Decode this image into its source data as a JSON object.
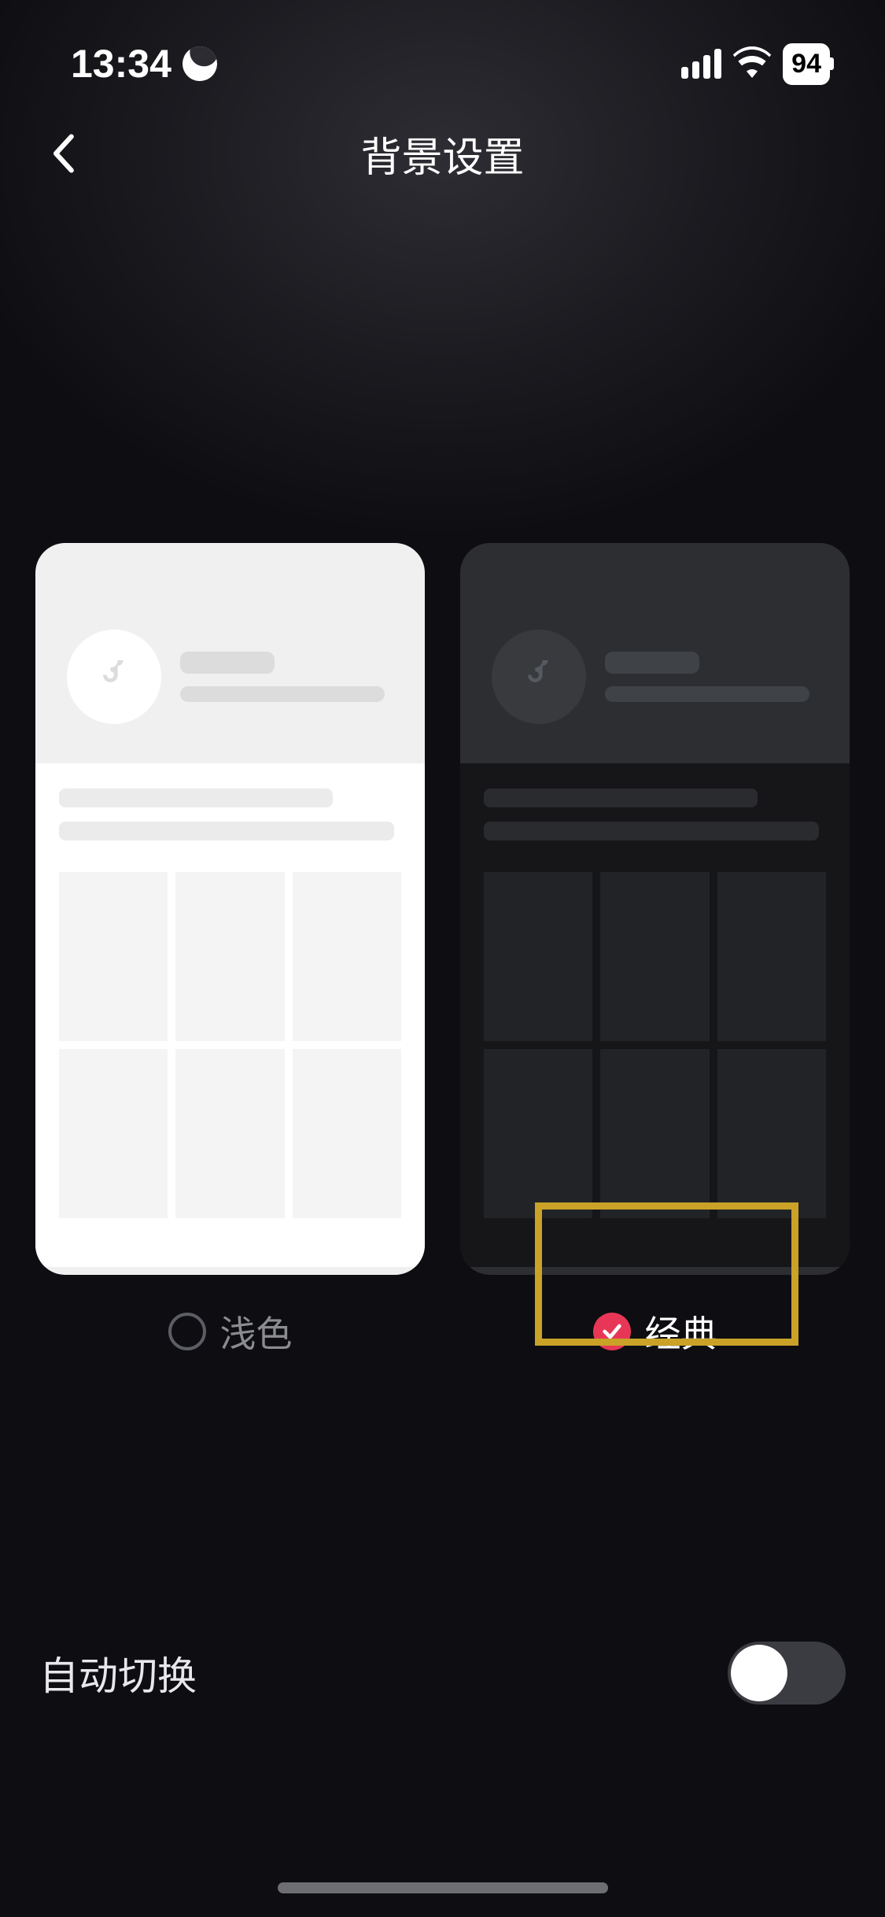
{
  "status": {
    "time": "13:34",
    "battery": "94"
  },
  "header": {
    "title": "背景设置"
  },
  "themes": {
    "light_label": "浅色",
    "classic_label": "经典",
    "selected": "classic"
  },
  "autoSwitch": {
    "label": "自动切换",
    "enabled": false
  },
  "colors": {
    "accent": "#e83756",
    "highlight": "#c9a227"
  }
}
